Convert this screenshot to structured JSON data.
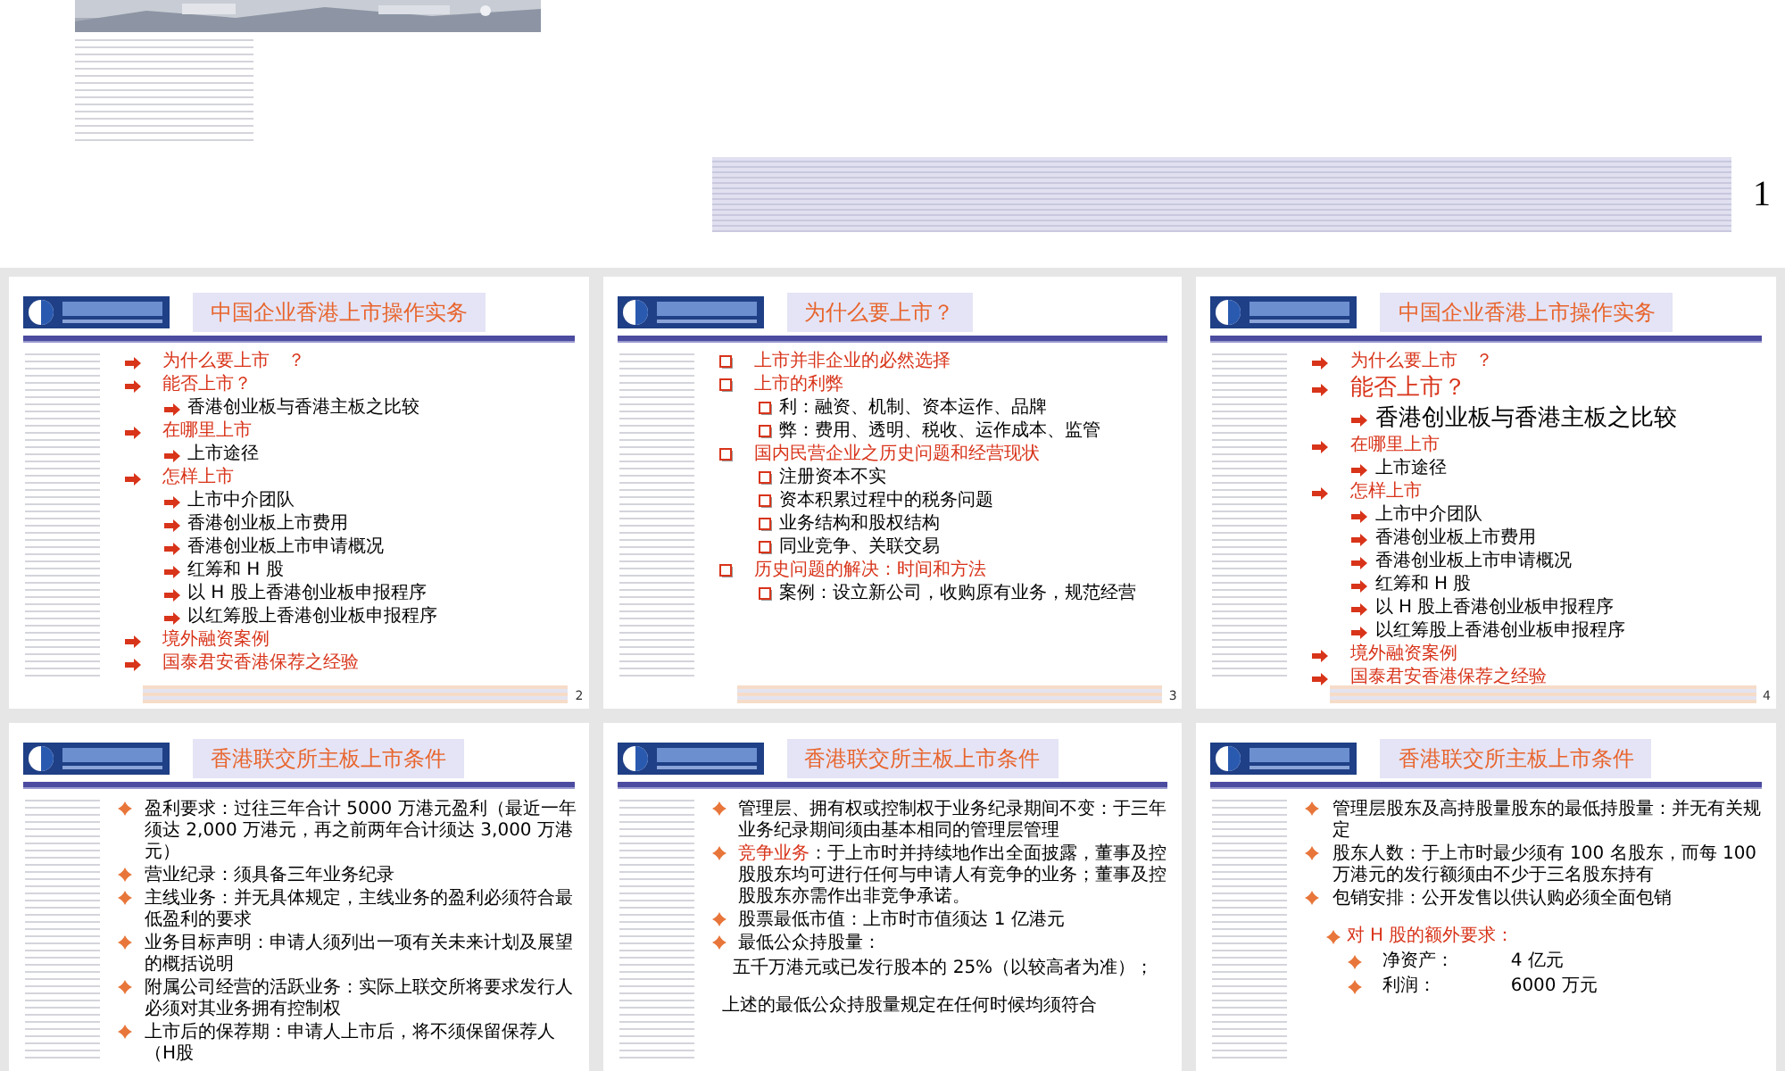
{
  "slides": [
    {
      "kind": "cover",
      "number": "1"
    },
    {
      "kind": "arrows",
      "title": "中国企业香港上市操作实务",
      "number": "2",
      "items": [
        {
          "text": "为什么要上市　？"
        },
        {
          "text": "能否上市？",
          "children": [
            {
              "text": "香港创业板与香港主板之比较"
            }
          ]
        },
        {
          "text": "在哪里上市",
          "children": [
            {
              "text": "上市途径"
            }
          ]
        },
        {
          "text": "怎样上市",
          "children": [
            {
              "text": "上市中介团队"
            },
            {
              "text": "香港创业板上市费用"
            },
            {
              "text": "香港创业板上市申请概况"
            },
            {
              "text": "红筹和 H 股"
            },
            {
              "text": "以 H 股上香港创业板申报程序"
            },
            {
              "text": "以红筹股上香港创业板申报程序"
            }
          ]
        },
        {
          "text": "境外融资案例"
        },
        {
          "text": "国泰君安香港保荐之经验"
        }
      ]
    },
    {
      "kind": "squares",
      "title": "为什么要上市？",
      "number": "3",
      "items": [
        {
          "text": "上市并非企业的必然选择"
        },
        {
          "text": "上市的利弊",
          "children": [
            {
              "text": "利：融资、机制、资本运作、品牌"
            },
            {
              "text": "弊：费用、透明、税收、运作成本、监管"
            }
          ]
        },
        {
          "text": "国内民营企业之历史问题和经营现状",
          "children": [
            {
              "text": "注册资本不实"
            },
            {
              "text": "资本积累过程中的税务问题"
            },
            {
              "text": "业务结构和股权结构"
            },
            {
              "text": "同业竞争、关联交易"
            }
          ]
        },
        {
          "text": "历史问题的解决：时间和方法",
          "children": [
            {
              "text": "案例：设立新公司，收购原有业务，规范经营"
            }
          ]
        }
      ]
    },
    {
      "kind": "arrows",
      "title": "中国企业香港上市操作实务",
      "number": "4",
      "items": [
        {
          "text": "为什么要上市　？",
          "emphasized": false
        },
        {
          "text": "能否上市？",
          "emphasized": true,
          "children": [
            {
              "text": "香港创业板与香港主板之比较",
              "emphasized": true
            }
          ]
        },
        {
          "text": "在哪里上市",
          "emphasized": false,
          "children": [
            {
              "text": "上市途径",
              "emphasized": false
            }
          ]
        },
        {
          "text": "怎样上市",
          "emphasized": false,
          "children": [
            {
              "text": "上市中介团队",
              "emphasized": false
            },
            {
              "text": "香港创业板上市费用",
              "emphasized": false
            },
            {
              "text": "香港创业板上市申请概况",
              "emphasized": false
            },
            {
              "text": "红筹和 H 股",
              "emphasized": false
            },
            {
              "text": "以 H 股上香港创业板申报程序",
              "emphasized": false
            },
            {
              "text": "以红筹股上香港创业板申报程序",
              "emphasized": false
            }
          ]
        },
        {
          "text": "境外融资案例",
          "emphasized": false
        },
        {
          "text": "国泰君安香港保荐之经验",
          "emphasized": false
        }
      ]
    },
    {
      "kind": "text",
      "title": "香港联交所主板上市条件",
      "items": [
        {
          "kind": "bullet",
          "text": "盈利要求：过往三年合计 5000 万港元盈利（最近一年须达 2,000 万港元，再之前两年合计须达 3,000 万港元）"
        },
        {
          "kind": "bullet",
          "text": "营业纪录：须具备三年业务纪录"
        },
        {
          "kind": "bullet",
          "text": "主线业务：并无具体规定，主线业务的盈利必须符合最低盈利的要求"
        },
        {
          "kind": "bullet",
          "text": "业务目标声明：申请人须列出一项有关未来计划及展望的概括说明"
        },
        {
          "kind": "bullet",
          "text": "附属公司经营的活跃业务：实际上联交所将要求发行人必须对其业务拥有控制权"
        },
        {
          "kind": "bullet",
          "text": "上市后的保荐期：申请人上市后，将不须保留保荐人（H股"
        }
      ]
    },
    {
      "kind": "text",
      "title": "香港联交所主板上市条件",
      "items": [
        {
          "kind": "bullet",
          "text": "管理层、拥有权或控制权于业务纪录期间不变：于三年业务纪录期间须由基本相同的管理层管理"
        },
        {
          "kind": "bullet",
          "lead": "竞争业务",
          "text": "：于上市时并持续地作出全面披露，董事及控股股东均可进行任何与申请人有竞争的业务；董事及控股股东亦需作出非竞争承诺。"
        },
        {
          "kind": "bullet",
          "text": "股票最低市值：上市时市值须达 1 亿港元"
        },
        {
          "kind": "bullet",
          "text": "最低公众持股量：",
          "children": [
            {
              "text": "五千万港元或已发行股本的 25%（以较高者为准）；"
            }
          ]
        },
        {
          "kind": "plain",
          "text": "上述的最低公众持股量规定在任何时候均须符合"
        }
      ]
    },
    {
      "kind": "text",
      "title": "香港联交所主板上市条件",
      "items": [
        {
          "kind": "bullet",
          "text": "管理层股东及高持股量股东的最低持股量：并无有关规定"
        },
        {
          "kind": "bullet",
          "text": "股东人数：于上市时最少须有 100 名股东，而每 100 万港元的发行额须由不少于三名股东持有"
        },
        {
          "kind": "bullet",
          "text": "包销安排：公开发售以供认购必须全面包销"
        },
        {
          "kind": "heading",
          "text": "对 H 股的额外要求：",
          "children": [
            {
              "label": "净资产：",
              "value": "4 亿元"
            },
            {
              "label": "利润：",
              "value": "6000 万元"
            }
          ]
        }
      ]
    }
  ]
}
